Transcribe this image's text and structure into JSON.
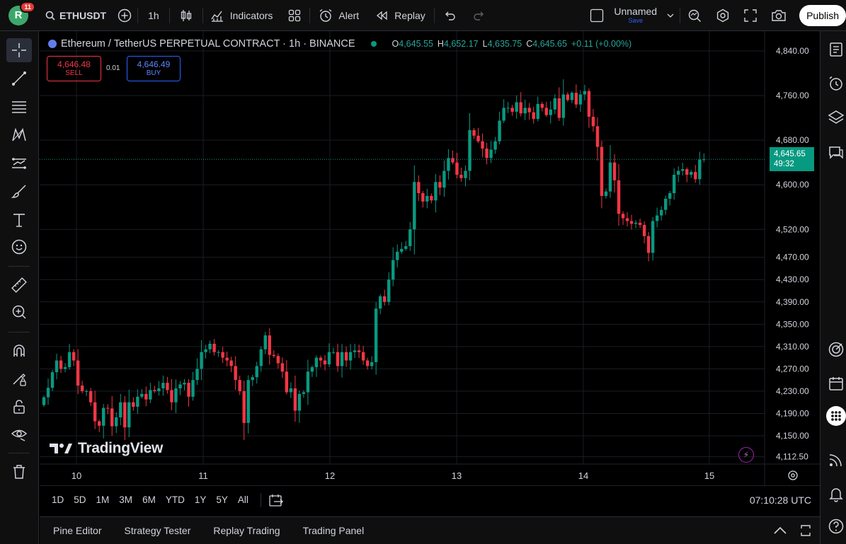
{
  "toolbar": {
    "avatar_letter": "R",
    "notification_count": "11",
    "symbol": "ETHUSDT",
    "interval": "1h",
    "indicators_label": "Indicators",
    "alert_label": "Alert",
    "replay_label": "Replay",
    "layout_name": "Unnamed",
    "save_label": "Save",
    "publish_label": "Publish"
  },
  "legend": {
    "title": "Ethereum / TetherUS PERPETUAL CONTRACT · 1h · BINANCE",
    "o_key": "O",
    "o_val": "4,645.55",
    "h_key": "H",
    "h_val": "4,652.17",
    "l_key": "L",
    "l_val": "4,635.75",
    "c_key": "C",
    "c_val": "4,645.65",
    "change": "+0.11 (+0.00%)"
  },
  "trade": {
    "sell_price": "4,646.48",
    "sell_label": "SELL",
    "spread": "0.01",
    "buy_price": "4,646.49",
    "buy_label": "BUY"
  },
  "watermark": "TradingView",
  "last_price": {
    "price": "4,645.65",
    "countdown": "49:32"
  },
  "chart_data": {
    "type": "candlestick",
    "y_ticks": [
      "4,840.00",
      "4,760.00",
      "4,680.00",
      "4,600.00",
      "4,520.00",
      "4,470.00",
      "4,430.00",
      "4,390.00",
      "4,350.00",
      "4,310.00",
      "4,270.00",
      "4,230.00",
      "4,190.00",
      "4,150.00",
      "4,112.50"
    ],
    "x_ticks": [
      "10",
      "11",
      "12",
      "13",
      "14",
      "15"
    ],
    "colors": {
      "up": "#089981",
      "down": "#f23645",
      "grid": "#1a1d26"
    },
    "closes": [
      4219,
      4236,
      4264,
      4285,
      4270,
      4273,
      4300,
      4285,
      4240,
      4230,
      4230,
      4210,
      4176,
      4168,
      4200,
      4199,
      4167,
      4183,
      4210,
      4165,
      4210,
      4202,
      4220,
      4225,
      4215,
      4232,
      4230,
      4235,
      4245,
      4232,
      4210,
      4235,
      4242,
      4245,
      4220,
      4250,
      4270,
      4300,
      4305,
      4315,
      4300,
      4300,
      4290,
      4285,
      4275,
      4250,
      4230,
      4173,
      4250,
      4255,
      4275,
      4305,
      4330,
      4295,
      4293,
      4280,
      4265,
      4228,
      4235,
      4195,
      4225,
      4228,
      4265,
      4273,
      4290,
      4285,
      4278,
      4300,
      4300,
      4275,
      4300,
      4285,
      4300,
      4303,
      4300,
      4285,
      4275,
      4282,
      4378,
      4400,
      4390,
      4430,
      4465,
      4480,
      4485,
      4490,
      4520,
      4605,
      4585,
      4570,
      4580,
      4572,
      4605,
      4595,
      4625,
      4648,
      4640,
      4618,
      4612,
      4625,
      4698,
      4688,
      4678,
      4665,
      4648,
      4663,
      4678,
      4715,
      4738,
      4738,
      4731,
      4748,
      4728,
      4738,
      4730,
      4718,
      4745,
      4738,
      4725,
      4735,
      4755,
      4720,
      4762,
      4752,
      4765,
      4744,
      4762,
      4768,
      4722,
      4705,
      4668,
      4580,
      4588,
      4640,
      4608,
      4548,
      4540,
      4535,
      4530,
      4532,
      4528,
      4508,
      4478,
      4535,
      4545,
      4555,
      4575,
      4585,
      4618,
      4625,
      4628,
      4618,
      4623,
      4610,
      4645,
      4646
    ]
  }
}
